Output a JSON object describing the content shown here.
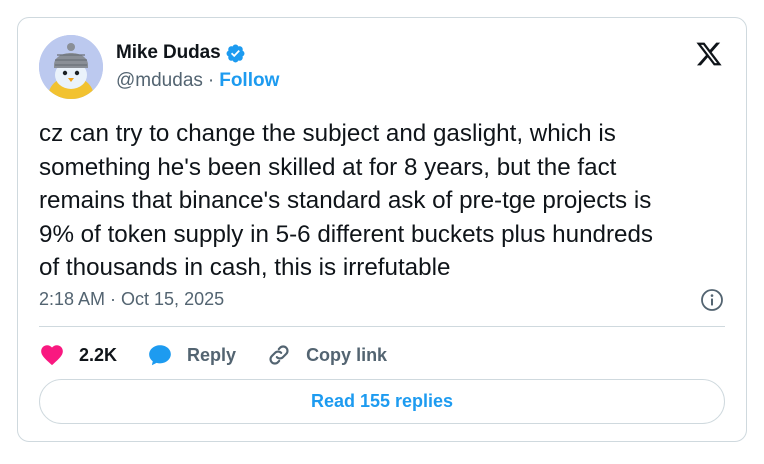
{
  "author": {
    "name": "Mike Dudas",
    "handle": "@mdudas",
    "separator": "·",
    "follow_label": "Follow"
  },
  "tweet": {
    "text": "cz can try to change the subject and gaslight, which is\nsomething he's been skilled at for 8 years, but the fact\nremains that binance's standard ask of pre-tge projects is\n9% of token supply in 5-6 different buckets plus hundreds\nof thousands in cash, this is irrefutable",
    "timestamp": "2:18 AM · Oct 15, 2025"
  },
  "actions": {
    "likes": "2.2K",
    "reply_label": "Reply",
    "copy_link_label": "Copy link"
  },
  "read_replies_label": "Read 155 replies",
  "colors": {
    "accent": "#1d9bf0",
    "like": "#f91880",
    "text": "#0f1419",
    "muted": "#536471",
    "border": "#cfd9de"
  },
  "icons": {
    "verified": "verified-badge-icon",
    "x_logo": "x-logo-icon",
    "info": "info-icon",
    "like": "heart-icon",
    "reply": "speech-bubble-icon",
    "copy_link": "link-icon"
  }
}
